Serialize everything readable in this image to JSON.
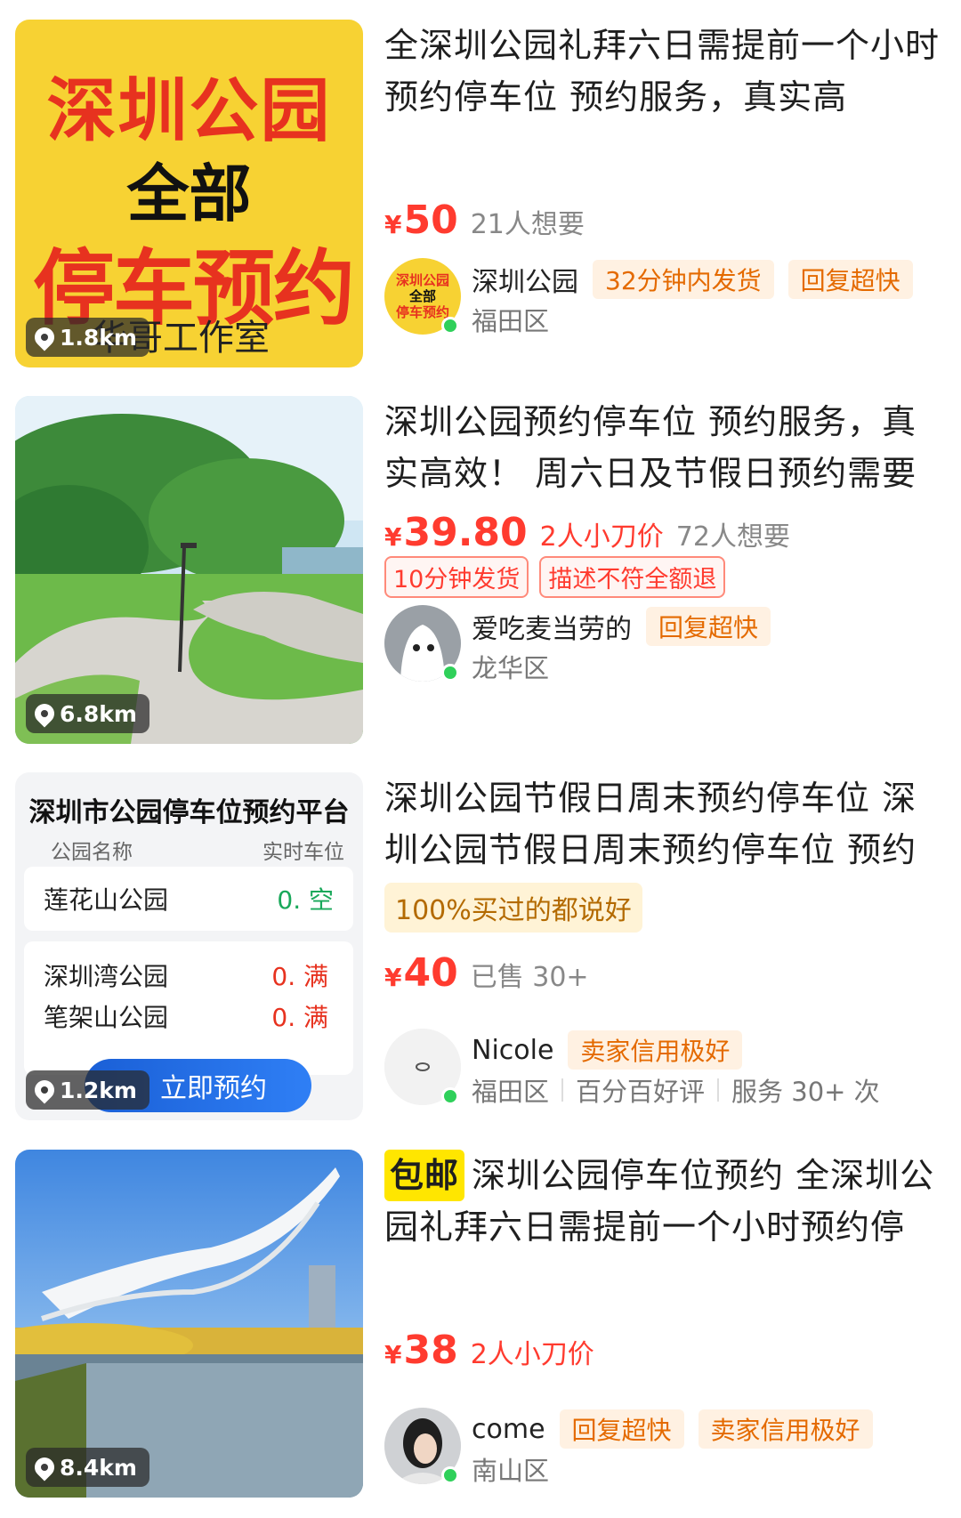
{
  "items": [
    {
      "thumb": {
        "line1": "深圳公园",
        "line2": "全部",
        "line3": "停车预约",
        "line4": "华哥工作室",
        "distance": "1.8km"
      },
      "title": "全深圳公园礼拜六日需提前一个小时预约停车位 预约服务，真实高",
      "price_symbol": "¥",
      "price": "50",
      "want": "21人想要",
      "seller": {
        "name": "深圳公园",
        "chips": [
          "32分钟内发货",
          "回复超快"
        ],
        "location": "福田区",
        "avatar_lines": [
          "深圳公园",
          "全部",
          "停车预约"
        ]
      }
    },
    {
      "thumb": {
        "distance": "6.8km"
      },
      "title": "深圳公园预约停车位 预约服务，真实高效！ 周六日及节假日预约需要",
      "price_symbol": "¥",
      "price": "39.80",
      "cut": "2人小刀价",
      "want": "72人想要",
      "badges": [
        "10分钟发货",
        "描述不符全额退"
      ],
      "seller": {
        "name": "爱吃麦当劳的",
        "chips": [
          "回复超快"
        ],
        "location": "龙华区"
      }
    },
    {
      "thumb": {
        "header": "深圳市公园停车位预约平台",
        "col1": "公园名称",
        "col2": "实时车位",
        "rows": [
          {
            "park": "莲花山公园",
            "status": "0. 空"
          },
          {
            "park": "深圳湾公园",
            "status": "0. 满"
          },
          {
            "park": "笔架山公园",
            "status": "0. 满"
          }
        ],
        "button": "立即预约",
        "distance": "1.2km"
      },
      "title": "深圳公园节假日周末预约停车位 深圳公园节假日周末预约停车位 预约",
      "highlight": "100%买过的都说好",
      "price_symbol": "¥",
      "price": "40",
      "sold": "已售 30+",
      "seller": {
        "name": "Nicole",
        "chips": [
          "卖家信用极好"
        ],
        "location": "福田区",
        "extra1": "百分百好评",
        "extra2": "服务 30+ 次"
      }
    },
    {
      "thumb": {
        "distance": "8.4km"
      },
      "free_tag": "包邮",
      "title": "深圳公园停车位预约 全深圳公园礼拜六日需提前一个小时预约停",
      "price_symbol": "¥",
      "price": "38",
      "cut": "2人小刀价",
      "seller": {
        "name": "come",
        "chips": [
          "回复超快",
          "卖家信用极好"
        ],
        "location": "南山区"
      }
    }
  ]
}
